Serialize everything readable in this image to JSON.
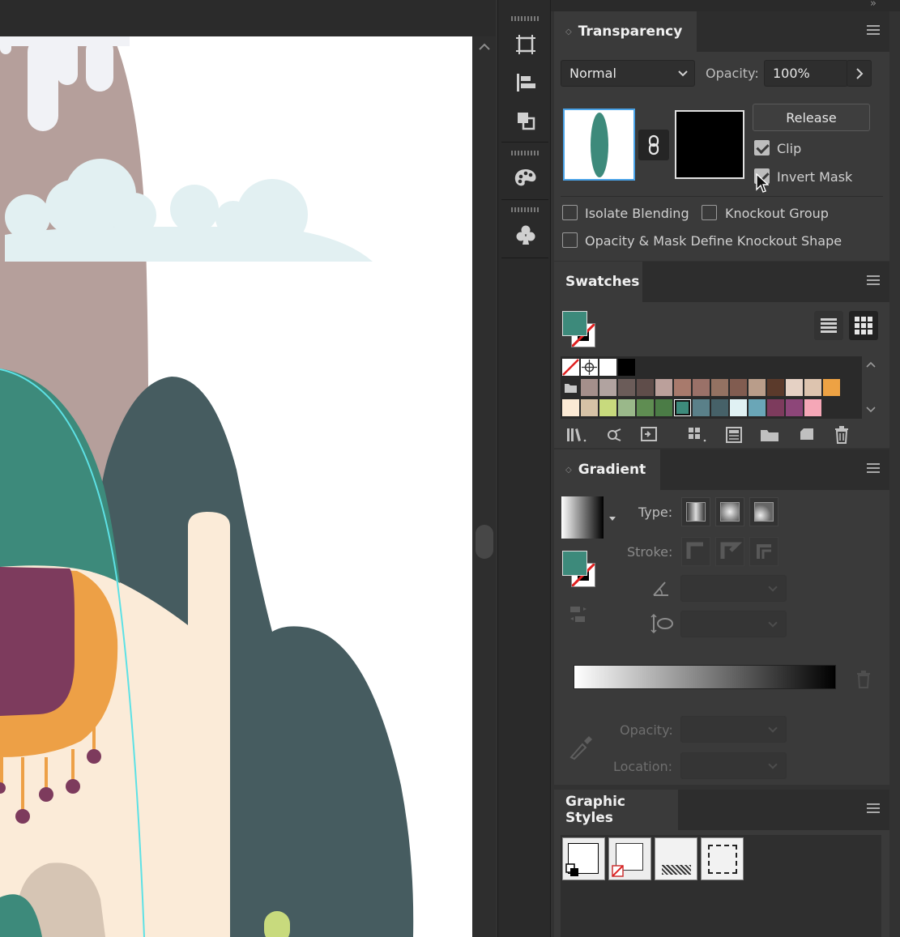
{
  "transparency": {
    "title": "Transparency",
    "blend_mode": "Normal",
    "opacity_label": "Opacity:",
    "opacity_value": "100%",
    "release_label": "Release",
    "clip_label": "Clip",
    "clip_checked": true,
    "invert_mask_label": "Invert Mask",
    "invert_mask_checked": true,
    "isolate_blending_label": "Isolate Blending",
    "knockout_group_label": "Knockout Group",
    "opacity_mask_knockout_label": "Opacity & Mask Define Knockout Shape"
  },
  "swatches": {
    "title": "Swatches",
    "fill_color": "#3d8a7b",
    "rows": [
      [
        "#a48f8b",
        "#b1a3a0",
        "#6b5c59",
        "#5f4d4a",
        "#bba09b",
        "#a87a6c",
        "#9a7168",
        "#947262",
        "#815c50",
        "#b99d8a",
        "#5b3a2b",
        "#e5d1c4",
        "#ddc4af",
        "#eda244"
      ],
      [
        "#fbe9d4",
        "#d6c2a6",
        "#c8da7d",
        "#9ab88a",
        "#5f8d52",
        "#4b7c46",
        "#3d8a7b",
        "#5a8089",
        "#466168",
        "#e0f1f3",
        "#6aa6b7",
        "#7d3b5d",
        "#8d4679",
        "#f5a7b7"
      ]
    ]
  },
  "gradient": {
    "title": "Gradient",
    "type_label": "Type:",
    "stroke_label": "Stroke:",
    "opacity_label": "Opacity:",
    "location_label": "Location:"
  },
  "graphic_styles": {
    "title": "Graphic Styles"
  },
  "colors": {
    "teal": "#3d8a7b",
    "dark_slate": "#465c60",
    "mauve": "#b59f9b",
    "cream": "#fbebd8",
    "orange": "#eda046",
    "plum": "#7d3b5d",
    "cloud": "#e2f0f2"
  }
}
